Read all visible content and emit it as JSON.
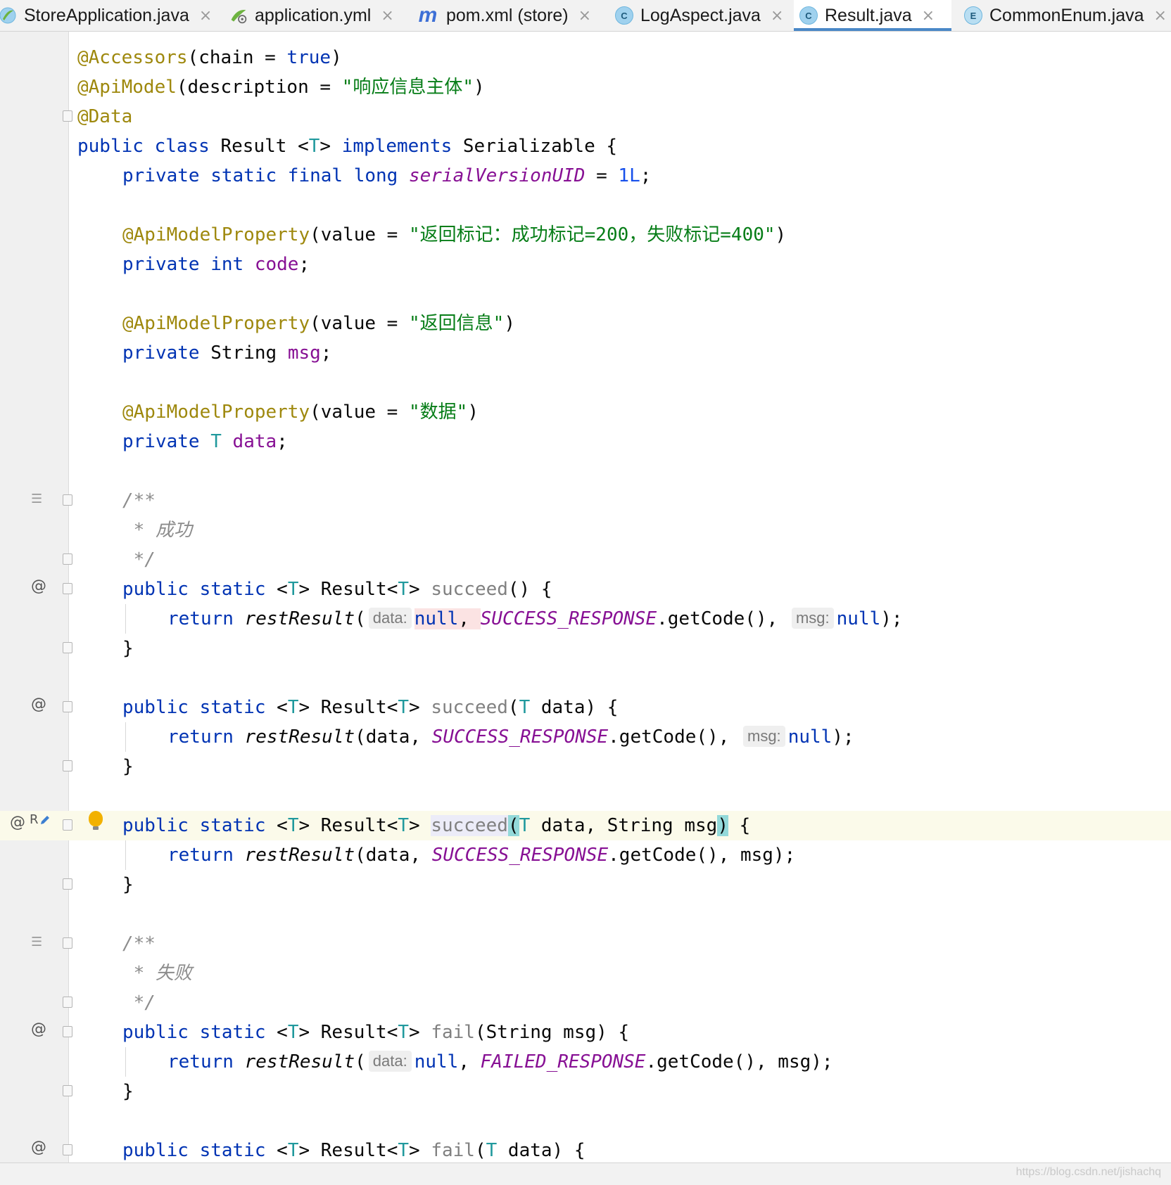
{
  "tabs": [
    {
      "label": "StoreApplication.java",
      "icon": "spring-class-icon"
    },
    {
      "label": "application.yml",
      "icon": "spring-config-icon"
    },
    {
      "label": "pom.xml (store)",
      "icon": "maven-icon",
      "glyph": "m"
    },
    {
      "label": "LogAspect.java",
      "icon": "class-icon",
      "glyph": "C"
    },
    {
      "label": "Result.java",
      "icon": "class-icon",
      "glyph": "C",
      "active": true
    },
    {
      "label": "CommonEnum.java",
      "icon": "enum-icon",
      "glyph": "E"
    }
  ],
  "close_glyph": "×",
  "gutter": {
    "override_glyph": "@",
    "rename_glyph": "R",
    "doc_glyph": "☰"
  },
  "code": {
    "l1_a": "@Accessors",
    "l1_b": "(chain = ",
    "l1_c": "true",
    "l1_d": ")",
    "l2_a": "@ApiModel",
    "l2_b": "(description = ",
    "l2_c": "\"响应信息主体\"",
    "l2_d": ")",
    "l3_a": "@Data",
    "l4_a": "public class",
    "l4_b": " Result <",
    "l4_c": "T",
    "l4_d": "> ",
    "l4_e": "implements",
    "l4_f": " Serializable {",
    "l5_a": "private static final long ",
    "l5_b": "serialVersionUID",
    "l5_c": " = ",
    "l5_d": "1L",
    "l5_e": ";",
    "l7_a": "@ApiModelProperty",
    "l7_b": "(value = ",
    "l7_c": "\"返回标记：成功标记=200，失败标记=400\"",
    "l7_d": ")",
    "l8_a": "private int ",
    "l8_b": "code",
    "l8_c": ";",
    "l10_a": "@ApiModelProperty",
    "l10_b": "(value = ",
    "l10_c": "\"返回信息\"",
    "l10_d": ")",
    "l11_a": "private ",
    "l11_b": "String ",
    "l11_c": "msg",
    "l11_d": ";",
    "l13_a": "@ApiModelProperty",
    "l13_b": "(value = ",
    "l13_c": "\"数据\"",
    "l13_d": ")",
    "l14_a": "private ",
    "l14_b": "T ",
    "l14_c": "data",
    "l14_d": ";",
    "c1_open": "/**",
    "c1_text": " * 成功",
    "c1_close": " */",
    "m1_a": "public static ",
    "m1_b": "<",
    "m1_c": "T",
    "m1_d": "> Result<",
    "m1_e": "T",
    "m1_f": "> ",
    "m1_g": "succeed",
    "m1_h": "() {",
    "r1_a": "return ",
    "r1_b": "restResult",
    "r1_c": "(",
    "r1_hint1": "data:",
    "r1_d": "null",
    "r1_e": ", ",
    "r1_f": "SUCCESS_RESPONSE",
    "r1_g": ".getCode(), ",
    "r1_hint2": "msg:",
    "r1_h": "null",
    "r1_i": ");",
    "close_brace": "}",
    "m2_a": "public static ",
    "m2_b": "<",
    "m2_c": "T",
    "m2_d": "> Result<",
    "m2_e": "T",
    "m2_f": "> ",
    "m2_g": "succeed",
    "m2_h": "(",
    "m2_i": "T",
    "m2_j": " data) {",
    "r2_a": "return ",
    "r2_b": "restResult",
    "r2_c": "(data, ",
    "r2_f": "SUCCESS_RESPONSE",
    "r2_g": ".getCode(), ",
    "r2_hint2": "msg:",
    "r2_h": "null",
    "r2_i": ");",
    "m3_a": "public static ",
    "m3_b": "<",
    "m3_c": "T",
    "m3_d": "> Result<",
    "m3_e": "T",
    "m3_f": "> ",
    "m3_g": "succeed",
    "m3_h": "(",
    "m3_i": "T",
    "m3_j": " data, String msg",
    "m3_k": ")",
    "m3_l": " {",
    "r3_a": "return ",
    "r3_b": "restResult",
    "r3_c": "(data, ",
    "r3_f": "SUCCESS_RESPONSE",
    "r3_g": ".getCode(), msg);",
    "c2_open": "/**",
    "c2_text": " * 失败",
    "c2_close": " */",
    "m4_a": "public static ",
    "m4_b": "<",
    "m4_c": "T",
    "m4_d": "> Result<",
    "m4_e": "T",
    "m4_f": "> ",
    "m4_g": "fail",
    "m4_h": "(String msg) {",
    "r4_a": "return ",
    "r4_b": "restResult",
    "r4_c": "(",
    "r4_hint1": "data:",
    "r4_d": "null",
    "r4_e": ", ",
    "r4_f": "FAILED_RESPONSE",
    "r4_g": ".getCode(), msg);",
    "m5_a": "public static ",
    "m5_b": "<",
    "m5_c": "T",
    "m5_d": "> Result<",
    "m5_e": "T",
    "m5_f": "> ",
    "m5_g": "fail",
    "m5_h": "(",
    "m5_i": "T",
    "m5_j": " data) {"
  },
  "watermark": "https://blog.csdn.net/jishachq"
}
